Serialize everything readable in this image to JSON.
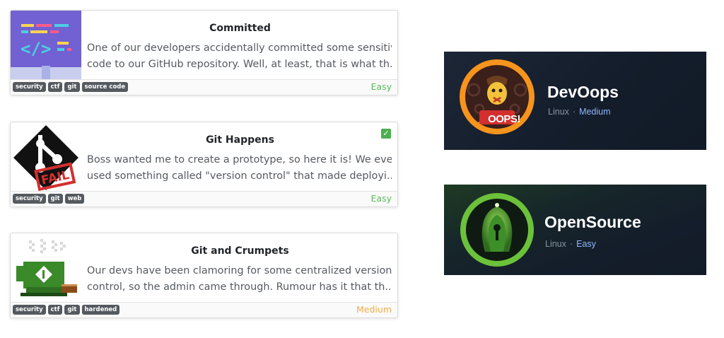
{
  "rooms": [
    {
      "title": "Committed",
      "desc_line1": "One of our developers accidentally committed some sensitive",
      "desc_line2": "code to our GitHub repository. Well, at least, that is what th...",
      "tags": [
        "security",
        "ctf",
        "git",
        "source code"
      ],
      "difficulty": "Easy",
      "thumb_icon": "code-editor-icon"
    },
    {
      "title": "Git Happens",
      "desc_line1": "Boss wanted me to create a prototype, so here it is! We even",
      "desc_line2": "used something called \"version control\" that made deployi...",
      "tags": [
        "security",
        "git",
        "web"
      ],
      "difficulty": "Easy",
      "completed_mark": "✓",
      "thumb_icon": "git-fail-icon"
    },
    {
      "title": "Git and Crumpets",
      "desc_line1": "Our devs have been clamoring for some centralized version",
      "desc_line2": "control, so the admin came through. Rumour has it that th...",
      "tags": [
        "security",
        "ctf",
        "git",
        "hardened"
      ],
      "difficulty": "Medium",
      "thumb_icon": "git-mug-icon"
    }
  ],
  "machines": [
    {
      "name": "DevOops",
      "os": "Linux",
      "separator": "·",
      "difficulty": "Medium",
      "logo_text": "OOPS!",
      "logo_icon": "devoops-logo-icon"
    },
    {
      "name": "OpenSource",
      "os": "Linux",
      "separator": "·",
      "difficulty": "Easy",
      "logo_icon": "opensource-logo-icon"
    }
  ],
  "colors": {
    "easy": "#5bb95b",
    "medium": "#f0ad4e",
    "tag_bg": "#555a60",
    "htb_bg": "#141d2b",
    "htb_difficulty": "#8fb8ff"
  }
}
